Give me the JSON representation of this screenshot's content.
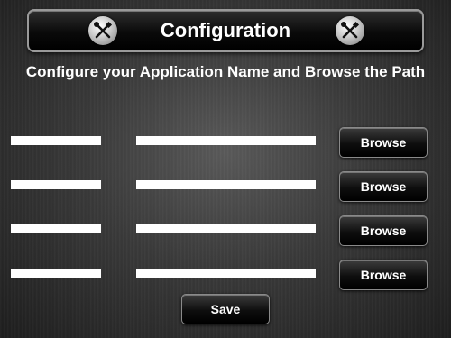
{
  "header": {
    "title": "Configuration",
    "icon_left": "tools-icon",
    "icon_right": "tools-icon"
  },
  "subtitle": "Configure your Application Name and Browse the Path",
  "rows": [
    {
      "app_name": "",
      "path": "",
      "browse_label": "Browse"
    },
    {
      "app_name": "",
      "path": "",
      "browse_label": "Browse"
    },
    {
      "app_name": "",
      "path": "",
      "browse_label": "Browse"
    },
    {
      "app_name": "",
      "path": "",
      "browse_label": "Browse"
    }
  ],
  "save_label": "Save",
  "colors": {
    "background": "#3a3a3a",
    "button": "#0e0e0e",
    "field": "#ffffff",
    "text": "#ffffff"
  }
}
